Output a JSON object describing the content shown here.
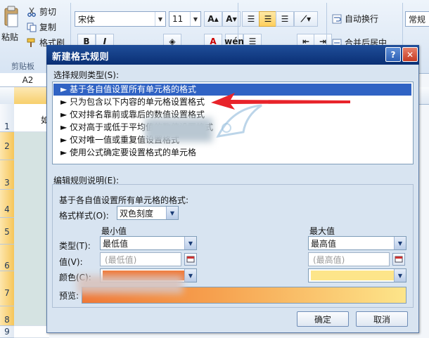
{
  "ribbon": {
    "paste_label": "粘贴",
    "cut_label": "剪切",
    "copy_label": "复制",
    "format_painter_label": "格式刷",
    "clipboard_group_label": "剪贴板",
    "font_name": "宋体",
    "font_size": "11",
    "wrap_text_label": "自动换行",
    "merge_center_label": "合并后居中",
    "number_format": "常规"
  },
  "sheet": {
    "name_box": "A2",
    "rows": [
      "1",
      "2",
      "3",
      "4",
      "5",
      "6",
      "7",
      "8",
      "9"
    ],
    "cell_a1_partial": "如"
  },
  "dialog": {
    "title": "新建格式规则",
    "help_label": "?",
    "close_label": "✕",
    "select_rule_type_label": "选择规则类型(S):",
    "rule_types": [
      "基于各自值设置所有单元格的格式",
      "只为包含以下内容的单元格设置格式",
      "仅对排名靠前或靠后的数值设置格式",
      "仅对高于或低于平均值的数值设置格式",
      "仅对唯一值或重复值设置格式",
      "使用公式确定要设置格式的单元格"
    ],
    "edit_rule_desc_label": "编辑规则说明(E):",
    "format_all_label": "基于各自值设置所有单元格的格式:",
    "format_style_label": "格式样式(O):",
    "format_style_value": "双色刻度",
    "min_header": "最小值",
    "max_header": "最大值",
    "type_label": "类型(T):",
    "min_type_value": "最低值",
    "max_type_value": "最高值",
    "value_label": "值(V):",
    "min_value_placeholder": "(最低值)",
    "max_value_placeholder": "(最高值)",
    "color_label": "颜色(C):",
    "preview_label": "预览:",
    "ok_label": "确定",
    "cancel_label": "取消"
  },
  "colors": {
    "title_bar": "#0a2f74",
    "selected_item": "#3063c4",
    "min_color": "#f07836",
    "max_color": "#fde58a",
    "arrow": "#e8232a"
  }
}
